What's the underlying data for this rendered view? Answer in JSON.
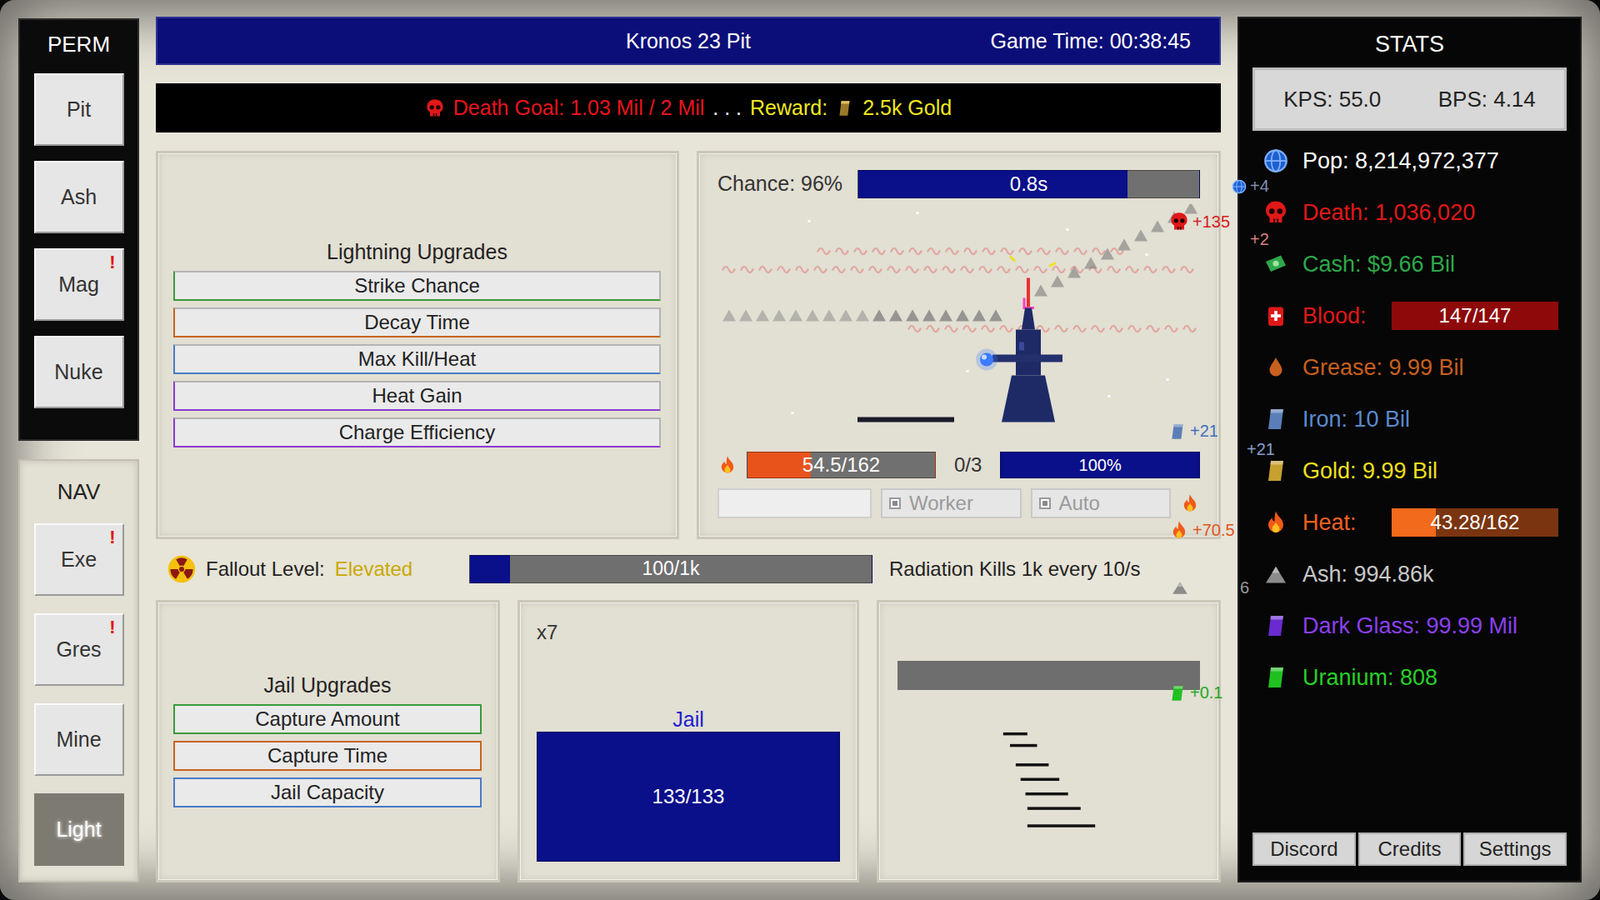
{
  "window": {
    "title": "Kronos 23 Pit",
    "time": "Game Time: 00:38:45"
  },
  "goal": {
    "label": "Death Goal: 1.03 Mil / 2 Mil",
    "separator": ". . .",
    "reward_label": "Reward:",
    "reward": "2.5k Gold"
  },
  "perm": {
    "title": "PERM",
    "items": [
      {
        "label": "Pit",
        "badge": ""
      },
      {
        "label": "Ash",
        "badge": ""
      },
      {
        "label": "Mag",
        "badge": "!"
      },
      {
        "label": "Nuke",
        "badge": ""
      }
    ]
  },
  "nav": {
    "title": "NAV",
    "items": [
      {
        "label": "Exe",
        "badge": "!",
        "selected": false
      },
      {
        "label": "Gres",
        "badge": "!",
        "selected": false
      },
      {
        "label": "Mine",
        "badge": "",
        "selected": false
      },
      {
        "label": "Light",
        "badge": "",
        "selected": true
      }
    ]
  },
  "lightning": {
    "title": "Lightning Upgrades",
    "upgrades": [
      {
        "label": "Strike Chance",
        "color": "#3a9a3a"
      },
      {
        "label": "Decay Time",
        "color": "#c8641e"
      },
      {
        "label": "Max Kill/Heat",
        "color": "#4a7ac8"
      },
      {
        "label": "Heat Gain",
        "color": "#8a3ad0"
      },
      {
        "label": "Charge Efficiency",
        "color": "#8a3ad0"
      }
    ]
  },
  "strike": {
    "chance": "Chance: 96%",
    "timer": {
      "reading": "0.8s",
      "level": 0.79
    },
    "heat": {
      "reading": "54.5/162",
      "level": 0.336
    },
    "charges": "0/3",
    "charge": {
      "reading": "100%",
      "level": 1
    },
    "toggles": [
      {
        "label": "Worker",
        "checked": true
      },
      {
        "label": "Auto",
        "checked": true
      }
    ]
  },
  "popups": [
    {
      "text": "+4",
      "color": "#8090b0"
    },
    {
      "text": "+135",
      "color": "#d42020"
    },
    {
      "text": "+2",
      "color": "#d98080"
    },
    {
      "text": "+21",
      "color": "#3f6fbf"
    },
    {
      "text": "+21",
      "color": "#8aa0cc"
    },
    {
      "text": "+70.5",
      "color": "#e0561c"
    },
    {
      "text": "6",
      "color": "#9a9a9a"
    },
    {
      "text": "+0.1",
      "color": "#1fa81f"
    }
  ],
  "fallout": {
    "label": "Fallout Level:",
    "status": "Elevated",
    "bar": {
      "reading": "100/1k",
      "level": 0.1
    },
    "note": "Radiation Kills 1k every 10/s"
  },
  "jail": {
    "title": "Jail Upgrades",
    "upgrades": [
      {
        "label": "Capture Amount",
        "color": "#3a9a3a"
      },
      {
        "label": "Capture Time",
        "color": "#c8641e"
      },
      {
        "label": "Jail Capacity",
        "color": "#4a7ac8"
      }
    ],
    "multiplier": "x7",
    "label": "Jail",
    "bar": {
      "reading": "133/133",
      "level": 1
    }
  },
  "mine": {
    "bar": {
      "level": 0
    }
  },
  "stats": {
    "title": "STATS",
    "kps": "KPS: 55.0",
    "bps": "BPS: 4.14",
    "items": [
      {
        "kind": "text",
        "label": "Pop: 8,214,972,377",
        "color": "#ffffff"
      },
      {
        "kind": "text",
        "label": "Death: 1,036,020",
        "color": "#e01818"
      },
      {
        "kind": "text",
        "label": "Cash: $9.66 Bil",
        "color": "#2ea84a"
      },
      {
        "kind": "bar",
        "label": "Blood:",
        "color": "#e01818",
        "reading": "147/147",
        "level": 1,
        "bar_color": "#8e0a0a",
        "track_color": "#5a0606"
      },
      {
        "kind": "text",
        "label": "Grease: 9.99 Bil",
        "color": "#c8601e"
      },
      {
        "kind": "text",
        "label": "Iron: 10 Bil",
        "color": "#5a8ad0"
      },
      {
        "kind": "text",
        "label": "Gold: 9.99 Bil",
        "color": "#f0e020"
      },
      {
        "kind": "bar",
        "label": "Heat:",
        "color": "#f06020",
        "reading": "43.28/162",
        "level": 0.267,
        "bar_color": "#f26a1b",
        "track_color": "#7a3510"
      },
      {
        "kind": "text",
        "label": "Ash: 994.86k",
        "color": "#c8c8c8"
      },
      {
        "kind": "text",
        "label": "Dark Glass: 99.99 Mil",
        "color": "#8a40f0"
      },
      {
        "kind": "text",
        "label": "Uranium: 808",
        "color": "#28d028"
      }
    ]
  },
  "footer": [
    "Discord",
    "Credits",
    "Settings"
  ]
}
